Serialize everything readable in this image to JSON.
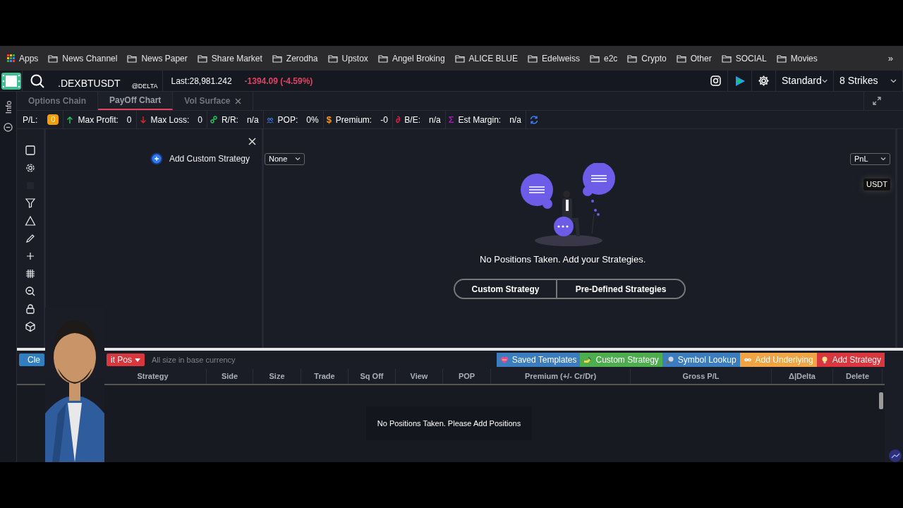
{
  "bookmarks": {
    "apps": "Apps",
    "folders": [
      "News Channel",
      "News Paper",
      "Share Market",
      "Zerodha",
      "Upstox",
      "Angel Broking",
      "ALICE BLUE",
      "Edelweiss",
      "e2c",
      "Crypto",
      "Other",
      "SOCIAL",
      "Movies"
    ],
    "more": "»"
  },
  "header": {
    "symbol": ".DEXBTUSDT",
    "exchange": "@DELTA",
    "last": "Last:28,981.242",
    "change": "-1394.09 (-4.59%)",
    "mode": "Standard",
    "strikes": "8 Strikes"
  },
  "side_rail": {
    "label": "Info"
  },
  "tabs": [
    {
      "label": "Options Chain",
      "selected": false,
      "closable": false
    },
    {
      "label": "PayOff Chart",
      "selected": true,
      "closable": false
    },
    {
      "label": "Vol Surface",
      "selected": false,
      "closable": true
    }
  ],
  "stats": [
    {
      "kind": "badge",
      "label": "P/L:",
      "value": "0"
    },
    {
      "kind": "up",
      "label": "Max Profit:",
      "value": "0"
    },
    {
      "kind": "down",
      "label": "Max Loss:",
      "value": "0"
    },
    {
      "kind": "link",
      "label": "R/R:",
      "value": "n/a"
    },
    {
      "kind": "pop",
      "label": "POP:",
      "value": "0%"
    },
    {
      "kind": "symbol",
      "symbol": "$",
      "color": "#f59e0b",
      "label": "Premium:",
      "value": "-0"
    },
    {
      "kind": "symbol",
      "symbol": "∂",
      "color": "#e11d48",
      "label": "B/E:",
      "value": "n/a"
    },
    {
      "kind": "symbol",
      "symbol": "Σ",
      "color": "#a21caf",
      "label": "Est Margin:",
      "value": "n/a"
    }
  ],
  "tools": [
    {
      "kind": "square"
    },
    {
      "kind": "gear"
    },
    {
      "kind": "blank"
    },
    {
      "kind": "filter"
    },
    {
      "kind": "triangle"
    },
    {
      "kind": "pencil"
    },
    {
      "kind": "plus"
    },
    {
      "kind": "grid"
    },
    {
      "kind": "zoom-out"
    },
    {
      "kind": "lock"
    },
    {
      "kind": "cube"
    }
  ],
  "strategy_panel": {
    "add_label": "Add Custom Strategy"
  },
  "chart": {
    "filter": "None",
    "metric": "PnL",
    "currency": "USDT",
    "message": "No Positions Taken. Add your Strategies.",
    "buttons": [
      "Custom Strategy",
      "Pre-Defined Strategies"
    ]
  },
  "positions": {
    "left_buttons": [
      {
        "label": "Cle",
        "color": "#2f7fc1"
      },
      {
        "label": "it Pos",
        "color": "#d9363e"
      }
    ],
    "note": "All size in base currency",
    "actions": [
      {
        "kind": "heart",
        "label": "Saved Templates",
        "color": "#3b7dbf"
      },
      {
        "kind": "hand",
        "label": "Custom Strategy",
        "color": "#4cae4c"
      },
      {
        "kind": "magnifier",
        "label": "Symbol Lookup",
        "color": "#3b7dbf"
      },
      {
        "kind": "infinity",
        "label": "Add Underlying",
        "color": "#f0a443"
      },
      {
        "kind": "bulb",
        "label": "Add Strategy",
        "color": "#d9363e"
      }
    ],
    "columns": [
      "Strategy",
      "Side",
      "Size",
      "Trade",
      "Sq Off",
      "View",
      "POP",
      "Premium (+/- Cr/Dr)",
      "Gross P/L",
      "Δ|Delta",
      "Delete"
    ],
    "empty": "No Positions Taken. Please Add Positions"
  }
}
